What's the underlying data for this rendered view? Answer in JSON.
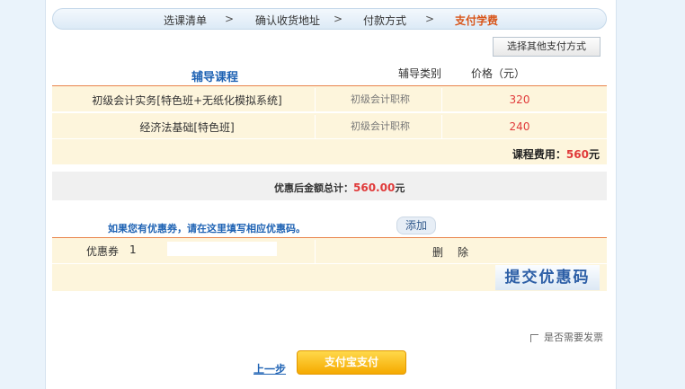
{
  "steps": [
    "选课清单",
    "确认收货地址",
    "付款方式",
    "支付学费"
  ],
  "step_arrow": ">",
  "other_payment_label": "选择其他支付方式",
  "table_headers": {
    "course": "辅导课程",
    "type": "辅导类别",
    "price": "价格（元）"
  },
  "courses": [
    {
      "name": "初级会计实务[特色班+无纸化模拟系统]",
      "type": "初级会计职称",
      "price": "320"
    },
    {
      "name": "经济法基础[特色班]",
      "type": "初级会计职称",
      "price": "240"
    }
  ],
  "course_fee": {
    "label": "课程费用：",
    "value": "560",
    "unit": "元"
  },
  "discount_total": {
    "label": "优惠后金额总计：",
    "value": "560.00",
    "unit": "元"
  },
  "coupon_hint": "如果您有优惠券，请在这里填写相应优惠码。",
  "add_label": "添加",
  "coupon": {
    "label": "优惠券",
    "number": "1",
    "value": "",
    "delete_label": "删除"
  },
  "submit_code_label": "提交优惠码",
  "invoice_label": "是否需要发票",
  "prev_label": "上一步",
  "alipay_label": "支付宝支付",
  "colors": {
    "accent_orange": "#d8561b",
    "link_blue": "#1f63b4",
    "price_red": "#e03a3a",
    "row_bg": "#fdf5dc"
  }
}
